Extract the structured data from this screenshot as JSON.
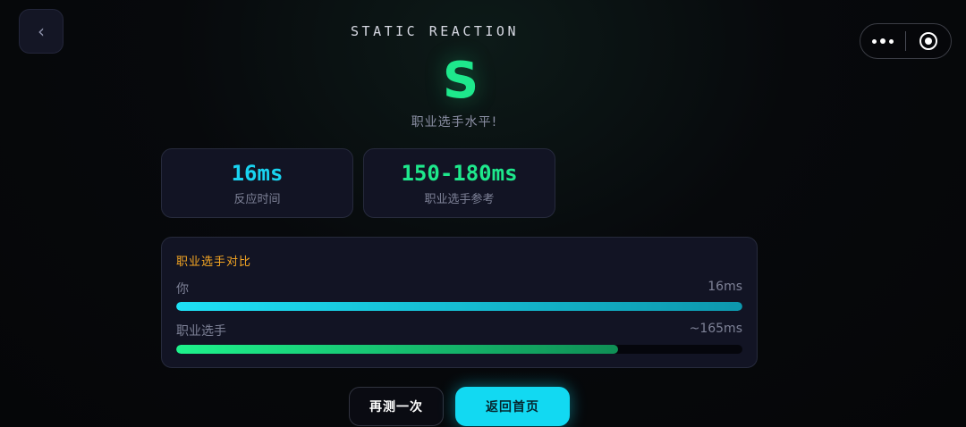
{
  "header": {
    "back_icon": "chevron-left-icon",
    "back_glyph": "‹",
    "title": "STATIC REACTION",
    "capsule": {
      "more_icon": "more-dots-icon",
      "close_icon": "target-circle-icon"
    }
  },
  "result": {
    "grade": "S",
    "caption": "职业选手水平!"
  },
  "stats": [
    {
      "value": "16ms",
      "label": "反应时间",
      "color": "#19d3f0"
    },
    {
      "value": "150-180ms",
      "label": "职业选手参考",
      "color": "#1ee88c"
    }
  ],
  "comparison": {
    "title": "职业选手对比",
    "rows": [
      {
        "label": "你",
        "value": "16ms",
        "fill_percent": 100
      },
      {
        "label": "职业选手",
        "value": "~165ms",
        "fill_percent": 78
      }
    ]
  },
  "actions": {
    "retry_label": "再测一次",
    "home_label": "返回首页"
  },
  "colors": {
    "accent_cyan": "#12d9f2",
    "accent_green": "#1ee88c",
    "accent_orange": "#f5a623",
    "card_bg": "#121424"
  }
}
